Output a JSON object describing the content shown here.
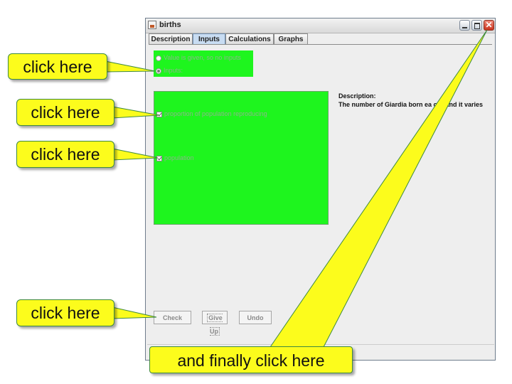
{
  "window": {
    "title": "births",
    "close_glyph": "✕"
  },
  "tabs": [
    "Description",
    "Inputs",
    "Calculations",
    "Graphs"
  ],
  "active_tab": "Inputs",
  "input_mode": {
    "option_given": "Value is given, so no inputs",
    "option_inputs": "Inputs:",
    "selected": "Inputs:"
  },
  "inputs": [
    {
      "label": "proportion of population reproducing",
      "checked": true
    },
    {
      "label": "population",
      "checked": true
    }
  ],
  "description": {
    "label": "Description:",
    "text": "The number of Giardia born ea      our and it varies"
  },
  "buttons": {
    "check": "Check",
    "give_up": "Give Up",
    "undo": "Undo"
  },
  "callouts": {
    "c1": "click here",
    "c2": "click here",
    "c3": "click here",
    "c4": "click here",
    "c5": "and finally click here"
  },
  "colors": {
    "highlight_green": "#1ef51e",
    "callout_yellow": "#fcfc1c"
  },
  "icons": [
    "app-icon",
    "minimize-icon",
    "maximize-icon",
    "close-icon"
  ]
}
